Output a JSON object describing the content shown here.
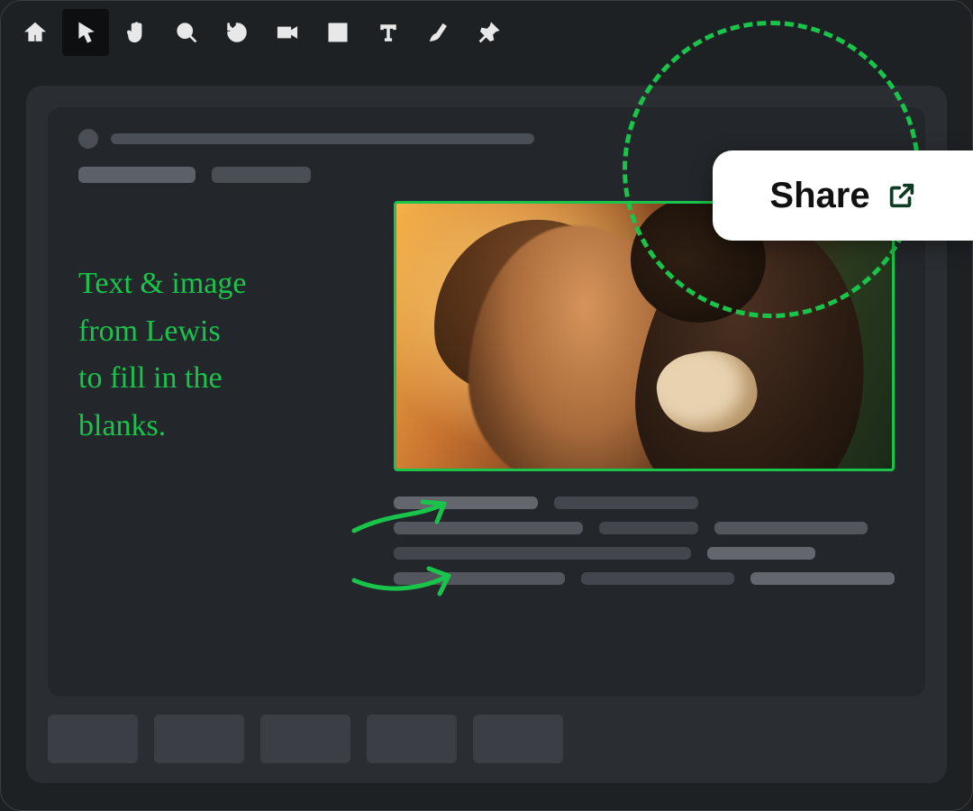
{
  "toolbar": {
    "tools": [
      {
        "name": "home",
        "active": false
      },
      {
        "name": "select",
        "active": true
      },
      {
        "name": "hand",
        "active": false
      },
      {
        "name": "zoom",
        "active": false
      },
      {
        "name": "reload",
        "active": false
      },
      {
        "name": "camera",
        "active": false
      },
      {
        "name": "frame",
        "active": false
      },
      {
        "name": "text",
        "active": false
      },
      {
        "name": "draw",
        "active": false
      },
      {
        "name": "pin",
        "active": false
      }
    ]
  },
  "share": {
    "label": "Share"
  },
  "annotation": {
    "text": "Text & image\nfrom Lewis\nto fill in the\nblanks.",
    "color": "#18c44a"
  },
  "image_placeholder": {
    "border_color": "#18c44a",
    "description": "romantic-couple-warm-light"
  }
}
